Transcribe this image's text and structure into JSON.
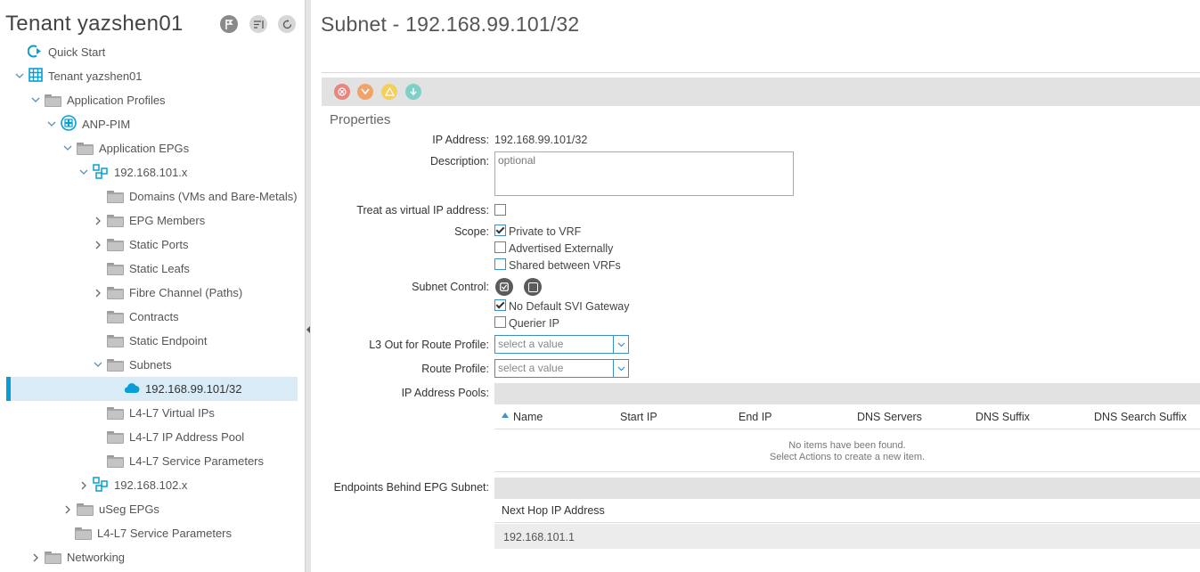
{
  "tenant": {
    "title": "Tenant yazshen01"
  },
  "tree": {
    "items": [
      {
        "label": "Quick Start"
      },
      {
        "label": "Tenant yazshen01"
      },
      {
        "label": "Application Profiles"
      },
      {
        "label": "ANP-PIM"
      },
      {
        "label": "Application EPGs"
      },
      {
        "label": "192.168.101.x"
      },
      {
        "label": "Domains (VMs and Bare-Metals)"
      },
      {
        "label": "EPG Members"
      },
      {
        "label": "Static Ports"
      },
      {
        "label": "Static Leafs"
      },
      {
        "label": "Fibre Channel (Paths)"
      },
      {
        "label": "Contracts"
      },
      {
        "label": "Static Endpoint"
      },
      {
        "label": "Subnets"
      },
      {
        "label": "192.168.99.101/32"
      },
      {
        "label": "L4-L7 Virtual IPs"
      },
      {
        "label": "L4-L7 IP Address Pool"
      },
      {
        "label": "L4-L7 Service Parameters"
      },
      {
        "label": "192.168.102.x"
      },
      {
        "label": "uSeg EPGs"
      },
      {
        "label": "L4-L7 Service Parameters"
      },
      {
        "label": "Networking"
      }
    ]
  },
  "page": {
    "title": "Subnet - 192.168.99.101/32",
    "section": "Properties"
  },
  "form": {
    "ip_address_label": "IP Address:",
    "ip_address_value": "192.168.99.101/32",
    "description_label": "Description:",
    "description_placeholder": "optional",
    "virtual_ip_label": "Treat as virtual IP address:",
    "scope_label": "Scope:",
    "scope_options": [
      {
        "label": "Private to VRF",
        "checked": true
      },
      {
        "label": "Advertised Externally",
        "checked": false
      },
      {
        "label": "Shared between VRFs",
        "checked": false
      }
    ],
    "subnet_control_label": "Subnet Control:",
    "subnet_control_options": [
      {
        "label": "No Default SVI Gateway",
        "checked": true
      },
      {
        "label": "Querier IP",
        "checked": false
      }
    ],
    "l3out_label": "L3 Out for Route Profile:",
    "l3out_placeholder": "select a value",
    "route_profile_label": "Route Profile:",
    "route_profile_placeholder": "select a value",
    "ip_pools_label": "IP Address Pools:",
    "ip_pools_columns": [
      "Name",
      "Start IP",
      "End IP",
      "DNS Servers",
      "DNS Suffix",
      "DNS Search Suffix"
    ],
    "ip_pools_empty_1": "No items have been found.",
    "ip_pools_empty_2": "Select Actions to create a new item.",
    "endpoints_label": "Endpoints Behind EPG Subnet:",
    "endpoints_column": "Next Hop IP Address",
    "endpoints_rows": [
      "192.168.101.1"
    ]
  },
  "colors": {
    "accent": "#049fd9",
    "toolbar_delete": "#e8857f",
    "toolbar_down": "#f0a36b",
    "toolbar_warn": "#f3cf5f",
    "toolbar_info": "#7fd0c8"
  }
}
